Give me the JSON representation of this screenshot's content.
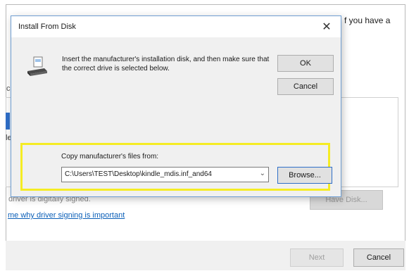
{
  "background": {
    "right_text_line1": "f you have a",
    "right_text_line2": "",
    "list_fragment_c": "c",
    "list_fragment_le": "le",
    "unsigned_text": "driver is digitally signed.",
    "have_disk_label": "Have Disk...",
    "signing_link": "me why driver signing is important",
    "next_label": "Next",
    "cancel_label": "Cancel"
  },
  "dialog": {
    "title": "Install From Disk",
    "close_glyph": "✕",
    "message": "Insert the manufacturer's installation disk, and then make sure that the correct drive is selected below.",
    "ok_label": "OK",
    "cancel_label": "Cancel",
    "copy_label": "Copy manufacturer's files from:",
    "path_value": "C:\\Users\\TEST\\Desktop\\kindle_mdis.inf_and64",
    "browse_label": "Browse...",
    "highlight_color": "#f5ec24"
  }
}
